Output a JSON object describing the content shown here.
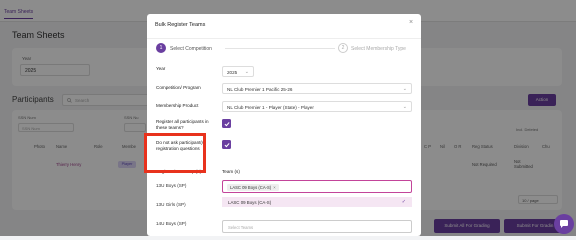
{
  "background": {
    "tab_label": "Team Sheets",
    "page_title": "Team Sheets",
    "year_label": "Year",
    "year_value": "2025",
    "participants_title": "Participants",
    "search_placeholder": "Search",
    "action_label": "Action",
    "filters": {
      "ssn_label": "SSN Num",
      "ssn_placeholder": "SSN Num",
      "ssn_label_2": "SSN Nu",
      "include_deleted": "Incl. Deleted"
    },
    "columns": [
      "Photo",
      "Name",
      "Role",
      "Membe",
      "C P",
      "Nil",
      "O R",
      "Reg Status",
      "Division",
      "Chu"
    ],
    "row": {
      "name": "Thierry Henry",
      "role": "Player",
      "reg_status": "Not Required",
      "division": "Not Submitted"
    },
    "pager_label": "10 / page",
    "submit_all": "Submit All For Grading",
    "submit_for": "Submit For Gradin"
  },
  "modal": {
    "title": "Bulk Register Teams",
    "step1_num": "1",
    "step1_label": "Select Competition",
    "step2_num": "2",
    "step2_label": "Select Membership Type",
    "year_label": "Year",
    "year_value": "2025",
    "competition_label": "Competition/ Program",
    "competition_value": "NL Club Premier 1 Pacific 25-26",
    "membership_label": "Membership Product",
    "membership_value": "NL Club Premier 1 - Player (State) - Player",
    "register_all_label": "Register all participants in these teams?",
    "do_not_ask_label": "Do not ask participant(s) registration questions",
    "reg_group_label": "Registration Group (s)",
    "teams_label": "Team (s)",
    "groups": [
      {
        "name": "13U Boys (SP)"
      },
      {
        "name": "13U Girls (SP)"
      },
      {
        "name": "14U Boys (SP)"
      }
    ],
    "selected_chip": "LASC 09 Boys (CA-S)",
    "chip_close": "×",
    "dropdown_option": "LASC 09 Boys (CA-S)",
    "select_placeholder": "Select Teams"
  },
  "colors": {
    "accent": "#6a3fa0",
    "highlight": "#e8321d"
  }
}
